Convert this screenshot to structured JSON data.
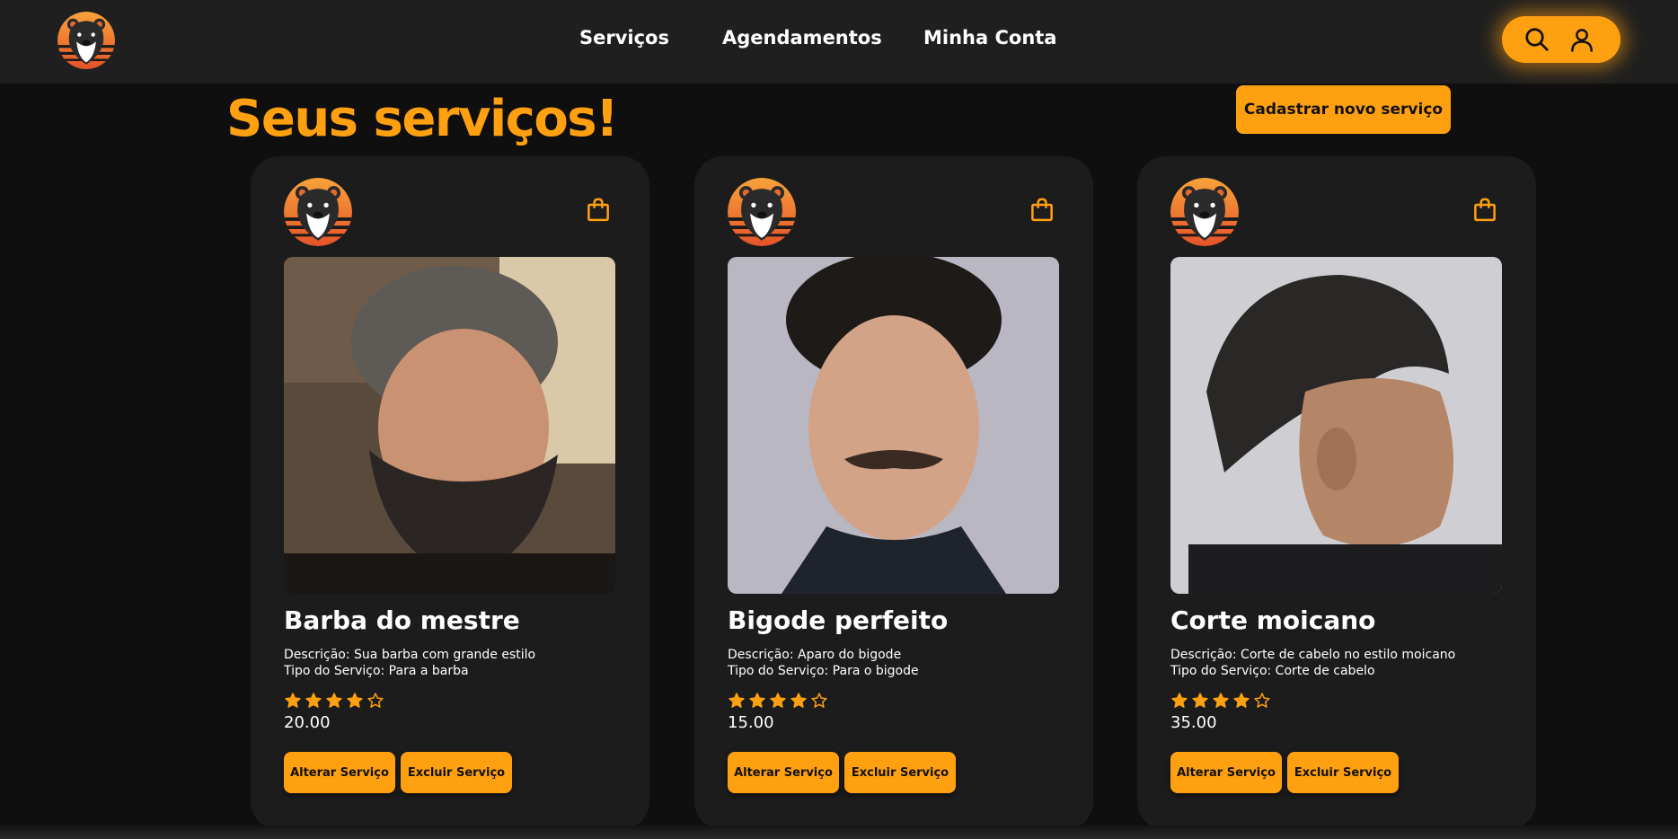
{
  "nav": {
    "links": [
      "Serviços",
      "Agendamentos",
      "Minha Conta"
    ],
    "icons": [
      "search-icon",
      "user-icon"
    ]
  },
  "page": {
    "title": "Seus serviços!",
    "new_service_button": "Cadastrar novo serviço"
  },
  "cards": [
    {
      "title": "Barba do mestre",
      "description": "Descrição: Sua barba com grande estilo",
      "type": "Tipo do Serviço: Para a barba",
      "rating": 4,
      "max_rating": 5,
      "price": "20.00",
      "alter_label": "Alterar Serviço",
      "delete_label": "Excluir Serviço"
    },
    {
      "title": "Bigode perfeito",
      "description": "Descrição: Aparo do bigode",
      "type": "Tipo do Serviço: Para o bigode",
      "rating": 4,
      "max_rating": 5,
      "price": "15.00",
      "alter_label": "Alterar Serviço",
      "delete_label": "Excluir Serviço"
    },
    {
      "title": "Corte moicano",
      "description": "Descrição: Corte de cabelo no estilo moicano",
      "type": "Tipo do Serviço: Corte de cabelo",
      "rating": 4,
      "max_rating": 5,
      "price": "35.00",
      "alter_label": "Alterar Serviço",
      "delete_label": "Excluir Serviço"
    }
  ],
  "colors": {
    "accent": "#ffa011",
    "background": "#0f0f0f",
    "navbar": "#1f1f1f",
    "card": "#1c1c1c"
  }
}
